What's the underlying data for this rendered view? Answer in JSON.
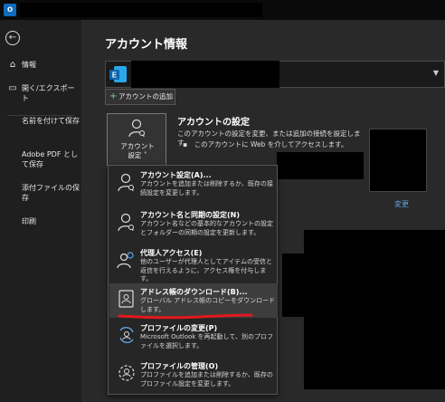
{
  "app": {
    "logo_letter": "o"
  },
  "sidebar": {
    "items": [
      {
        "name": "info",
        "icon": "⌂",
        "label": "情報"
      },
      {
        "name": "open-export",
        "icon": "▭",
        "label": "開く/エクスポート"
      },
      {
        "name": "save-as",
        "label": "名前を付けて保存"
      },
      {
        "name": "save-adobe-pdf",
        "label": "Adobe PDF として保存"
      },
      {
        "name": "save-attachments",
        "label": "添付ファイルの保存"
      },
      {
        "name": "print",
        "label": "印刷"
      }
    ],
    "back_icon": "←"
  },
  "main": {
    "page_title": "アカウント情報",
    "add_account_label": "アカウントの追加",
    "account_settings_tile_label_1": "アカウント",
    "account_settings_tile_label_2": "設定 ˅",
    "settings_heading": "アカウントの設定",
    "settings_desc": "このアカウントの設定を変更、または追加の接続を設定します。",
    "settings_bullet": "▪　このアカウントに Web を介してアクセスします。",
    "change_link": "変更"
  },
  "dropdown": {
    "items": [
      {
        "title": "アカウント設定(A)...",
        "desc": "アカウントを追加または削除するか、既存の接続設定を変更します。"
      },
      {
        "title": "アカウント名と同期の設定(N)",
        "desc": "アカウント名などの基本的なアカウントの設定とフォルダーの同期の設定を更新します。"
      },
      {
        "title": "代理人アクセス(E)",
        "desc": "他のユーザーが代理人としてアイテムの受信と返信を行えるように、アクセス権を付与します。"
      },
      {
        "title": "アドレス帳のダウンロード(B)...",
        "desc": "グローバル アドレス帳のコピーをダウンロードします。"
      },
      {
        "title": "プロファイルの変更(P)",
        "desc": "Microsoft Outlook を再起動して、別のプロファイルを選択します。"
      },
      {
        "title": "プロファイルの管理(O)",
        "desc": "プロファイルを追加または削除するか、既存のプロファイル設定を変更します。"
      }
    ]
  },
  "colors": {
    "accent": "#0f6cbd",
    "link": "#5ea4e8",
    "annotation": "#e0191e"
  }
}
